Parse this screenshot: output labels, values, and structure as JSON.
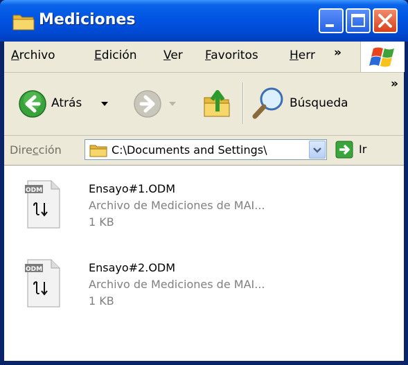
{
  "window": {
    "title": "Mediciones"
  },
  "menu": {
    "items": [
      {
        "prefix": "",
        "acc": "A",
        "rest": "rchivo"
      },
      {
        "prefix": "",
        "acc": "E",
        "rest": "dición"
      },
      {
        "prefix": "",
        "acc": "V",
        "rest": "er"
      },
      {
        "prefix": "",
        "acc": "F",
        "rest": "avoritos"
      },
      {
        "prefix": "",
        "acc": "H",
        "rest": "err"
      }
    ],
    "overflow": "»"
  },
  "toolbar": {
    "back_label": "Atrás",
    "search_label": "Búsqueda",
    "overflow": "»"
  },
  "address": {
    "label_prefix": "Dire",
    "label_acc": "c",
    "label_rest": "ción",
    "value": "C:\\Documents and Settings\\",
    "go_label": "Ir"
  },
  "files": [
    {
      "badge": "ODM",
      "name": "Ensayo#1.ODM",
      "type": "Archivo de Mediciones de MAI...",
      "size": "1 KB"
    },
    {
      "badge": "ODM",
      "name": "Ensayo#2.ODM",
      "type": "Archivo de Mediciones de MAI...",
      "size": "1 KB"
    }
  ],
  "colors": {
    "titlebar": "#0054e3",
    "close": "#d8401c",
    "face": "#ece9d8"
  }
}
